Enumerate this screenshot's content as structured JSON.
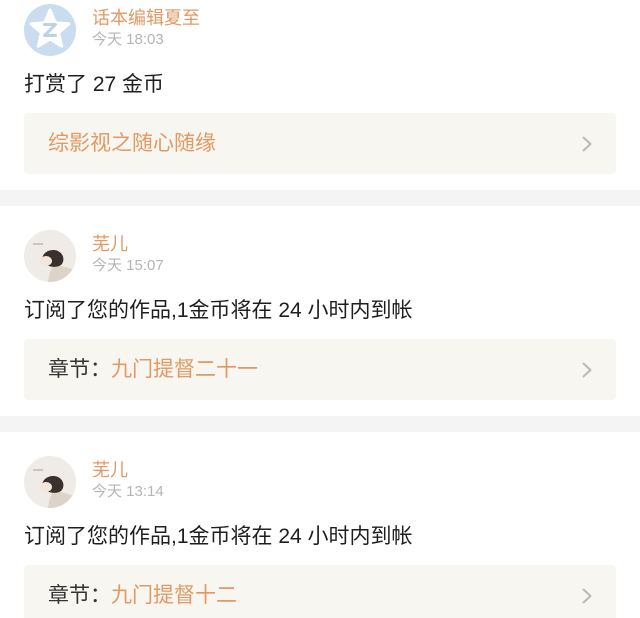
{
  "feed": {
    "items": [
      {
        "avatar_icon": "star-z-avatar-icon",
        "user_name": "话本编辑夏至",
        "time": "今天 18:03",
        "message": "打赏了 27 金币",
        "link": {
          "title": "综影视之随心随缘"
        }
      },
      {
        "avatar_icon": "user-photo-avatar",
        "user_name": "芜儿",
        "time": "今天 15:07",
        "message": "订阅了您的作品,1金币将在 24 小时内到帐",
        "link": {
          "prefix": "章节：",
          "title": "九门提督二十一"
        }
      },
      {
        "avatar_icon": "user-photo-avatar",
        "user_name": "芜儿",
        "time": "今天 13:14",
        "message": "订阅了您的作品,1金币将在 24 小时内到帐",
        "link": {
          "prefix": "章节：",
          "title": "九门提督十二"
        }
      }
    ],
    "link_icon": "chevron-right-icon"
  },
  "colors": {
    "accent": "#e29963",
    "link_box_bg": "#f8f6f0",
    "divider": "#f4f4f4",
    "muted": "#b5b5b5",
    "text": "#1f1f1f",
    "prefix": "#333333"
  }
}
